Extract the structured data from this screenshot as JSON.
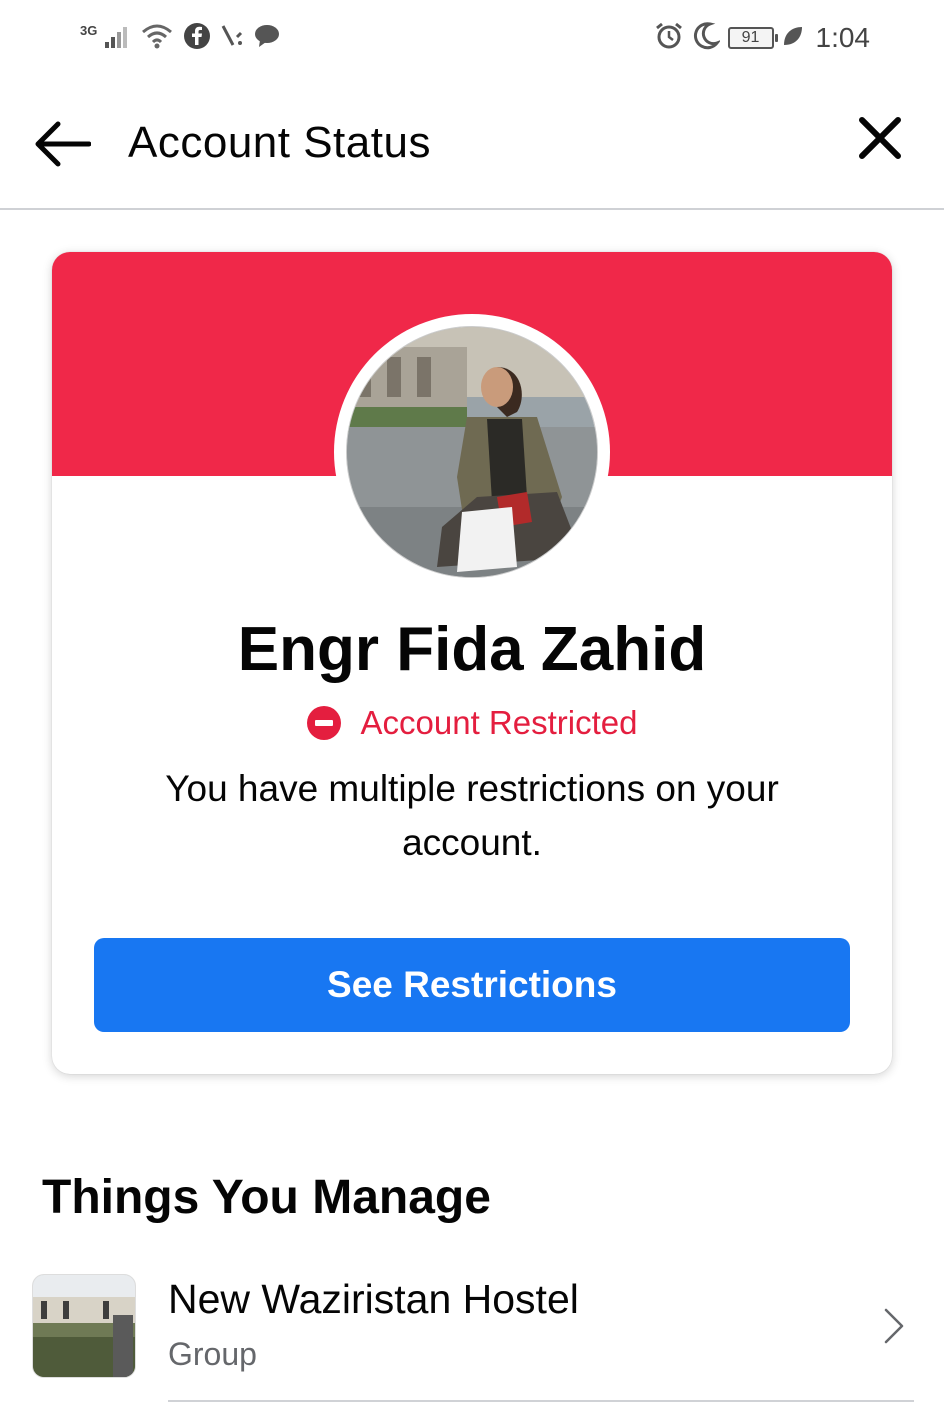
{
  "status_bar": {
    "network": "3G",
    "battery": "91",
    "time": "1:04",
    "icons": [
      "signal-icon",
      "wifi-icon",
      "facebook-icon",
      "tools-icon",
      "chat-bubble-icon",
      "alarm-icon",
      "moon-icon",
      "battery-icon",
      "leaf-icon"
    ]
  },
  "header": {
    "title": "Account Status",
    "back_icon": "back-arrow-icon",
    "close_icon": "close-icon"
  },
  "card": {
    "banner_color": "#f02849",
    "profile_name": "Engr Fida Zahid",
    "status_label": "Account Restricted",
    "status_color": "#e41e3f",
    "description": "You have multiple restrictions on your account.",
    "button_label": "See Restrictions",
    "button_color": "#1877f2"
  },
  "manage": {
    "title": "Things You Manage",
    "items": [
      {
        "title": "New Waziristan Hostel",
        "subtitle": "Group"
      }
    ]
  }
}
